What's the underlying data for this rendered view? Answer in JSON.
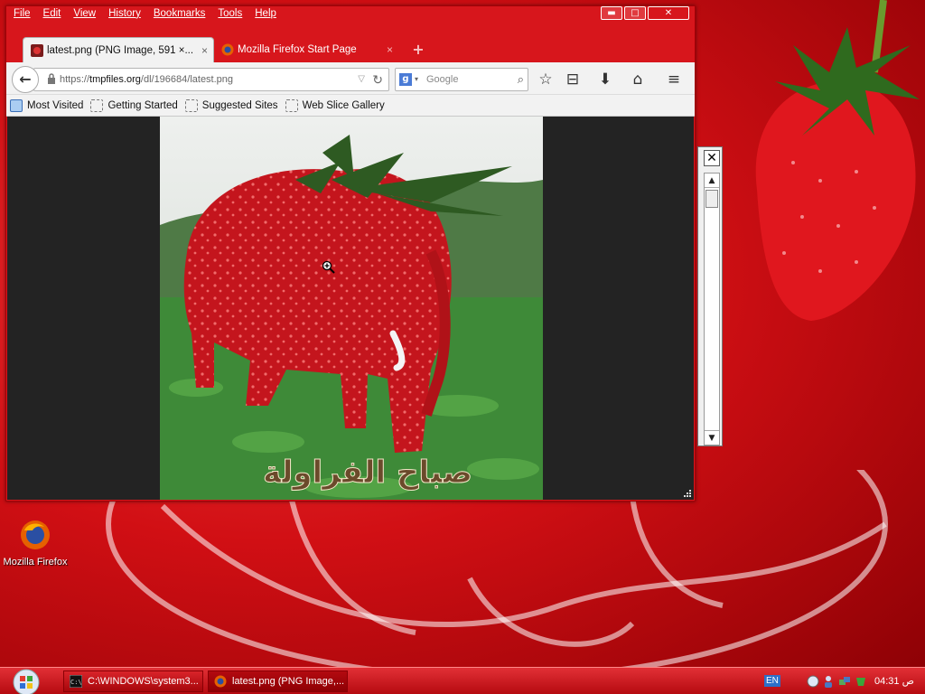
{
  "menubar": {
    "items": [
      "File",
      "Edit",
      "View",
      "History",
      "Bookmarks",
      "Tools",
      "Help"
    ]
  },
  "window_controls": {
    "minimize": "▬",
    "maximize": "□",
    "close": "✕"
  },
  "tabs": [
    {
      "label": "latest.png (PNG Image, 591 ×...",
      "close": "×",
      "active": true
    },
    {
      "label": "Mozilla Firefox Start Page",
      "close": "×",
      "active": false
    }
  ],
  "new_tab": "+",
  "navbar": {
    "back": "←",
    "url_prefix": "https://",
    "url_host": "tmpfiles.org",
    "url_path": "/dl/196684/latest.png",
    "url_dropdown": "▽",
    "reload": "↻",
    "search_placeholder": "Google",
    "search_engine": "g",
    "search_dropdown": "▾",
    "search_icon": "⌕",
    "tools": {
      "bookmark_star": "☆",
      "reading_list": "⊟",
      "downloads": "⬇",
      "home": "⌂",
      "menu": "≡"
    }
  },
  "bookmarks": [
    "Most Visited",
    "Getting Started",
    "Suggested Sites",
    "Web Slice Gallery"
  ],
  "image_caption": "صباح الفراولة",
  "desktop": {
    "firefox_icon_label": "Mozilla Firefox"
  },
  "taskbar": {
    "tasks": [
      "C:\\WINDOWS\\system3...",
      "latest.png (PNG Image,..."
    ],
    "language": "EN",
    "clock": "04:31 ص"
  },
  "bg_window": {
    "close": "✕",
    "scroll_up": "▲",
    "scroll_down": "▼"
  },
  "colors": {
    "theme_red": "#d7161c",
    "chrome_gray": "#f2f2f2",
    "photo_bg": "#232323"
  }
}
